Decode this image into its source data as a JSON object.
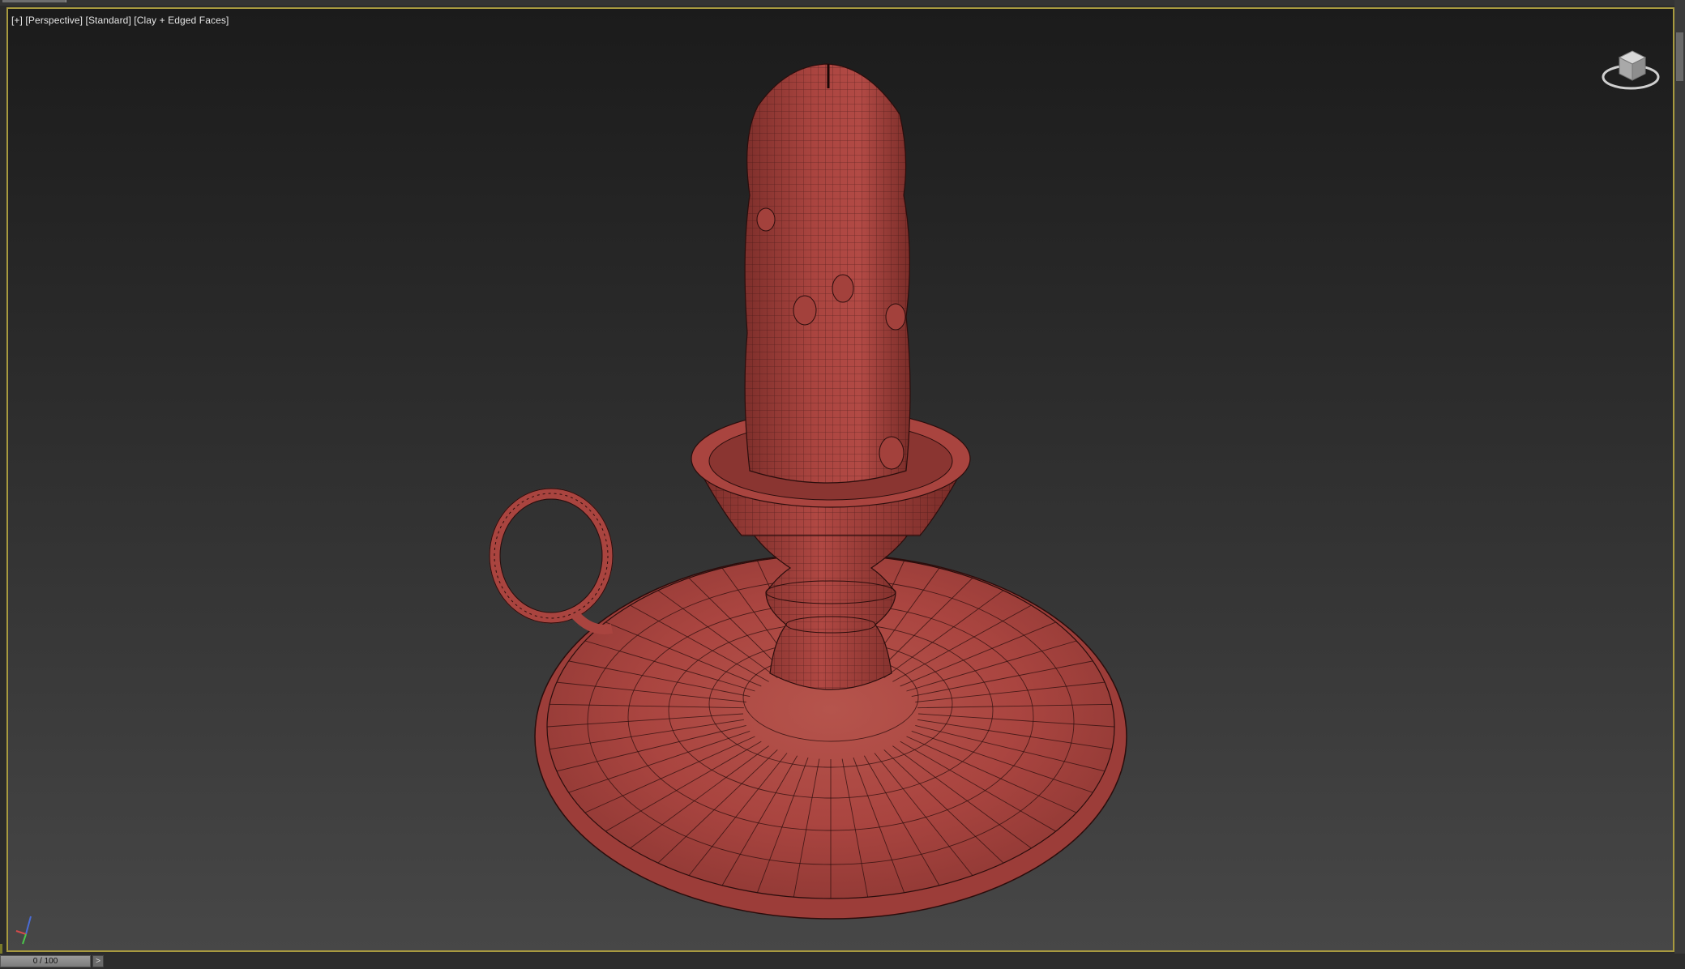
{
  "viewport": {
    "label": "[+] [Perspective] [Standard] [Clay + Edged Faces]",
    "model_color": "#b24a45",
    "wire_color": "#2a0d0c",
    "border_color": "#a89a3f"
  },
  "timeline": {
    "frame_readout": "0 / 100",
    "next_label": ">"
  },
  "icons": {
    "viewcube": "viewcube-icon",
    "axis": "axis-tripod-icon"
  }
}
